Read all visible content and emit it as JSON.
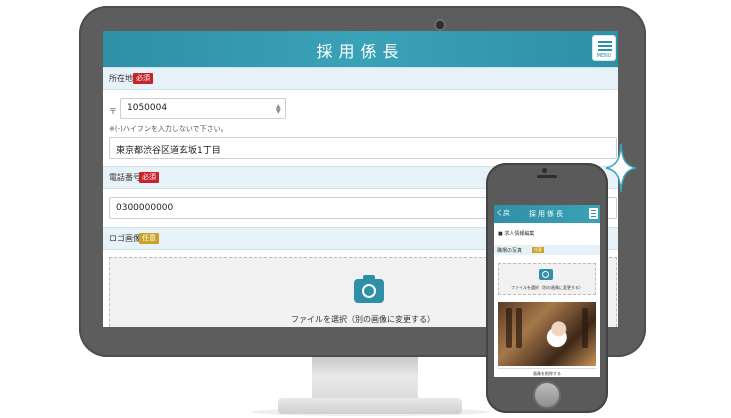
{
  "app": {
    "title": "採用係長",
    "menu_label": "MENU"
  },
  "form": {
    "address": {
      "label": "所在地",
      "badge": "必須",
      "postal_mark": "〒",
      "postal_value": "1050004",
      "postal_note": "※(-)ハイフンを入力しないで下さい。",
      "address_value": "東京都渋谷区道玄坂1丁目"
    },
    "phone": {
      "label": "電話番号",
      "badge": "必須",
      "value": "0300000000"
    },
    "logo": {
      "label": "ロゴ画像",
      "badge": "任意",
      "dropzone_text": "ファイルを選択（別の画像に変更する）"
    }
  },
  "phone_screen": {
    "back_label": "く戻",
    "title": "採用係長",
    "section_title": "■ 求人情報編集",
    "photo_label": "職場の写真",
    "photo_badge": "任意",
    "dropzone_text": "ファイルを選択（別の画像に変更する）",
    "delete_button": "画像を削除する"
  },
  "colors": {
    "header": "#2f8fa6",
    "required_badge": "#c8222a",
    "optional_badge": "#c9a227",
    "section_bg": "#e6f2f7"
  },
  "icons": [
    "camera-icon",
    "menu-icon",
    "back-icon",
    "sparkle-icon"
  ]
}
